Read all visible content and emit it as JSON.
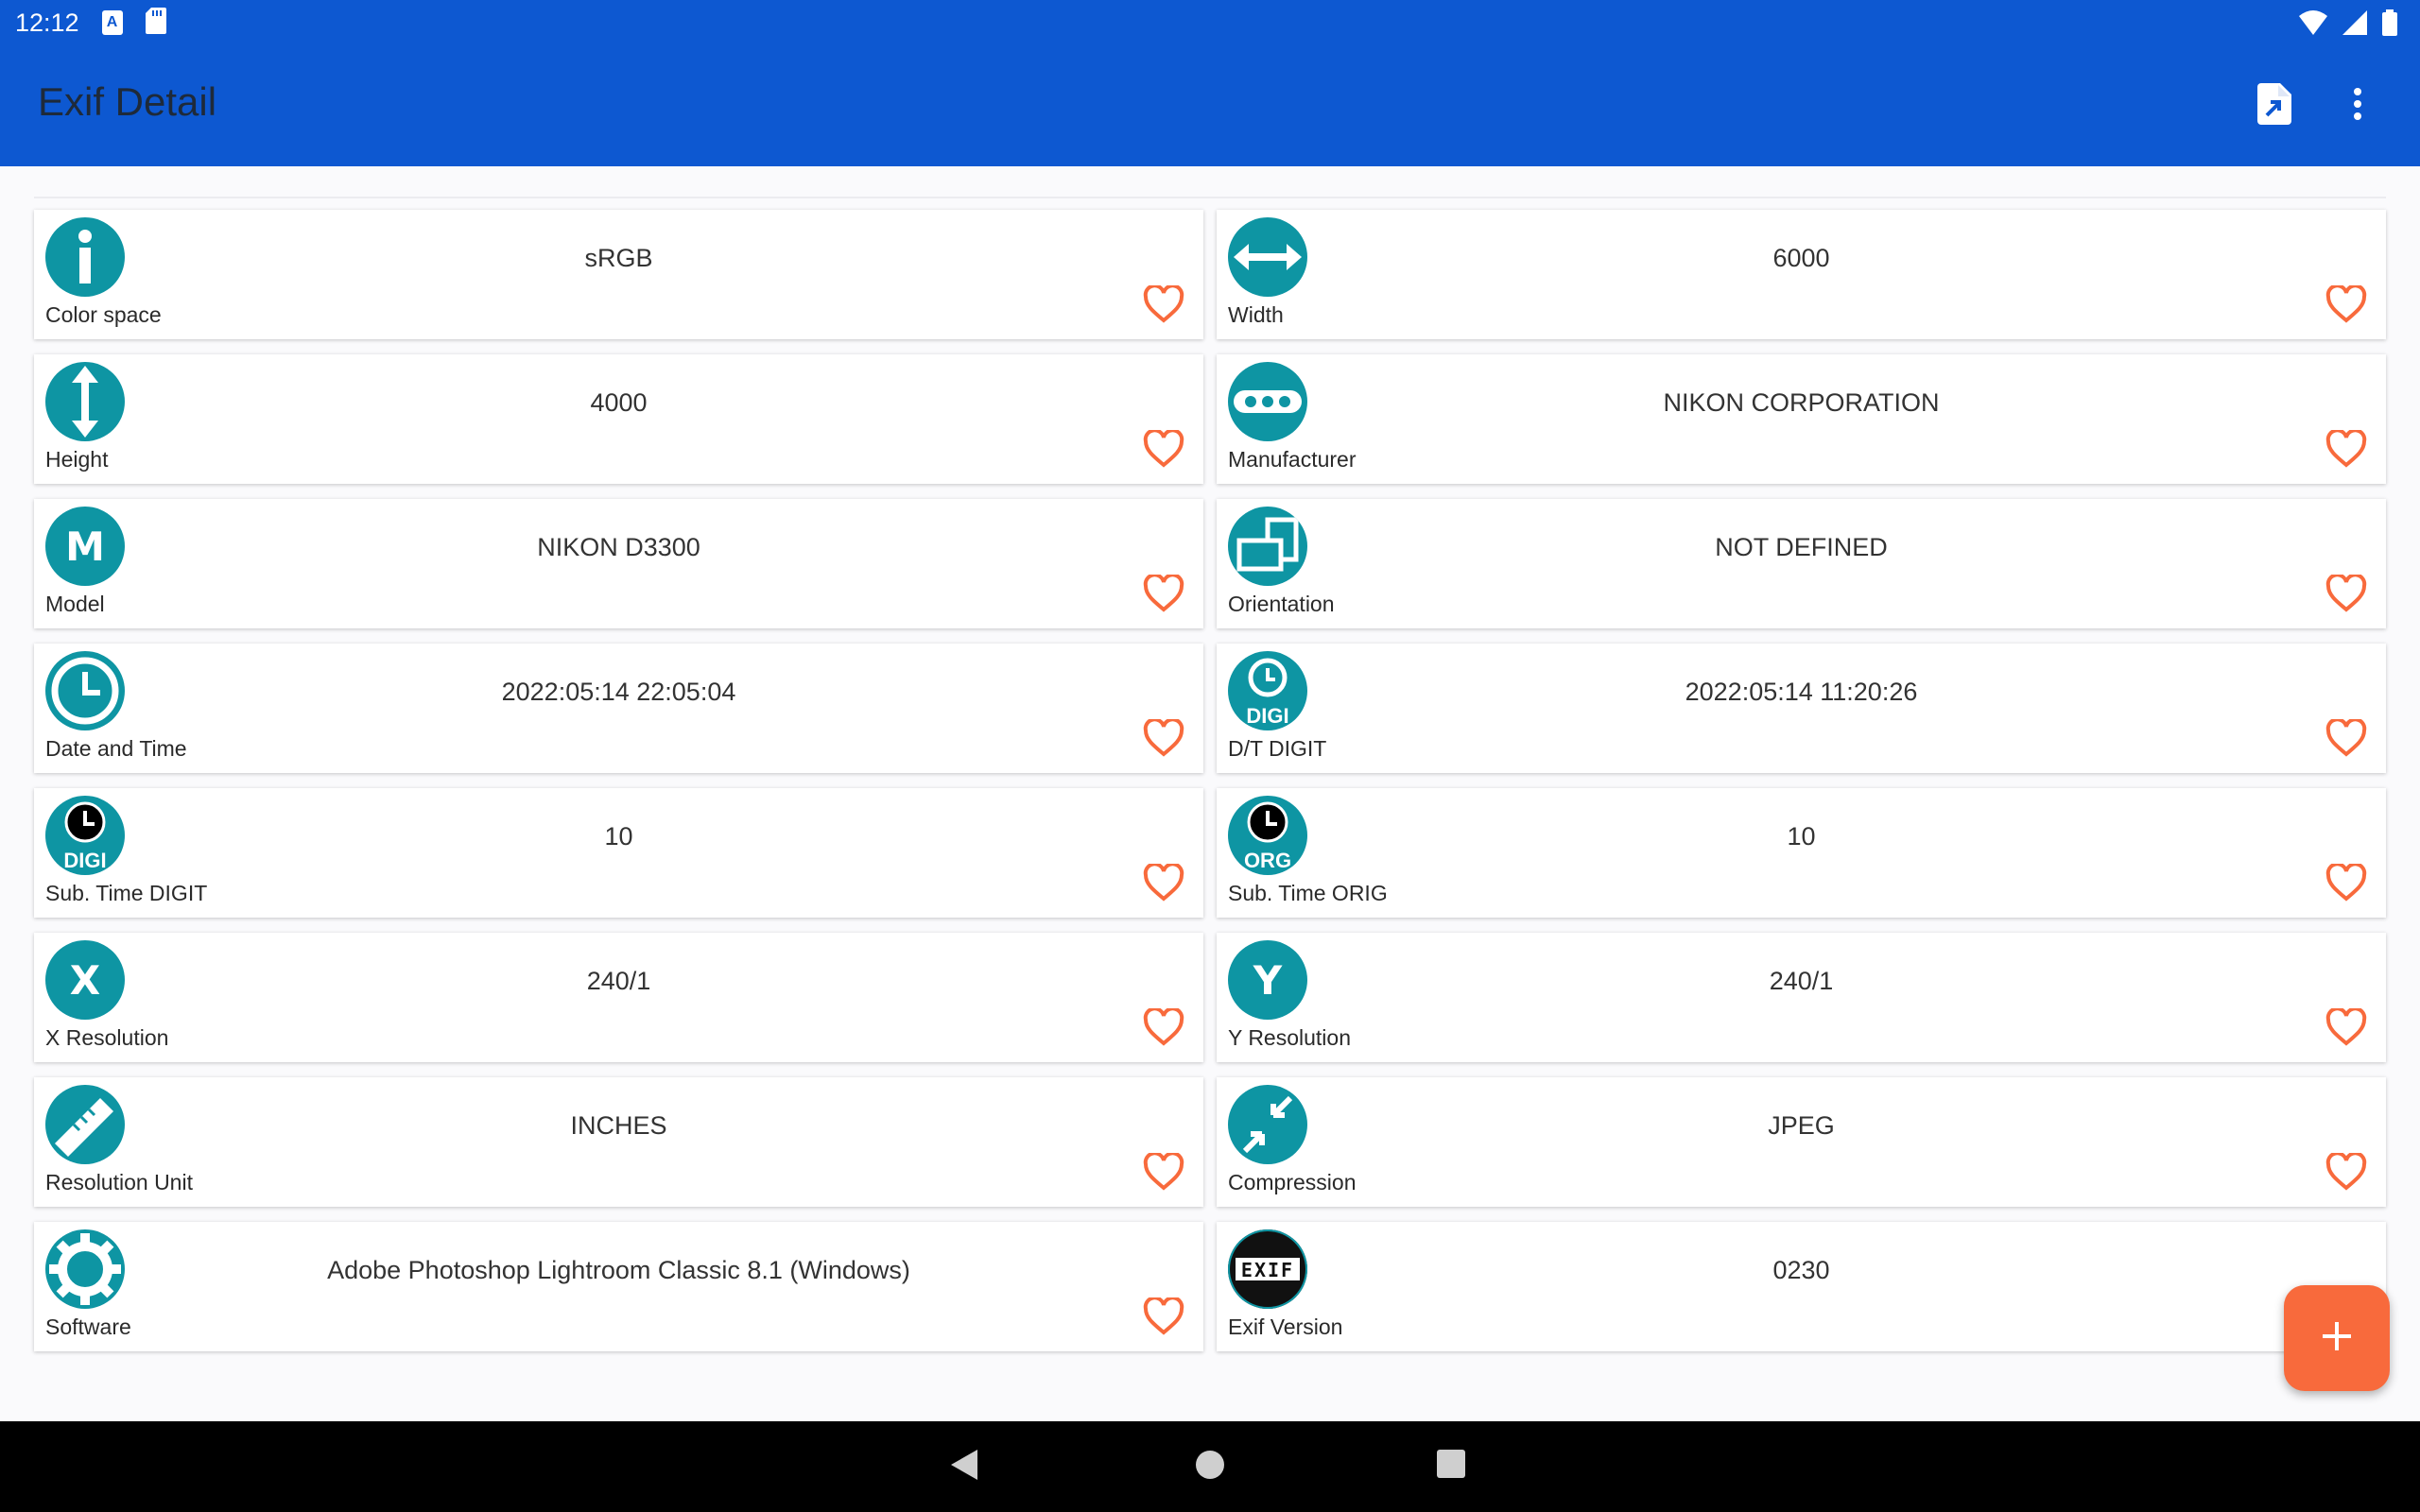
{
  "status": {
    "time": "12:12"
  },
  "app_bar": {
    "title": "Exif Detail"
  },
  "colors": {
    "primary": "#0d58d1",
    "icon_bg": "#0e95a3",
    "accent": "#f86a3c"
  },
  "items": [
    {
      "label": "Color space",
      "value": "sRGB",
      "icon": "info-icon"
    },
    {
      "label": "Width",
      "value": "6000",
      "icon": "width-arrows-icon"
    },
    {
      "label": "Height",
      "value": "4000",
      "icon": "height-arrows-icon"
    },
    {
      "label": "Manufacturer",
      "value": "NIKON CORPORATION",
      "icon": "manufacturer-icon"
    },
    {
      "label": "Model",
      "value": "NIKON D3300",
      "icon": "model-icon"
    },
    {
      "label": "Orientation",
      "value": "NOT DEFINED",
      "icon": "orientation-icon"
    },
    {
      "label": "Date and Time",
      "value": "2022:05:14 22:05:04",
      "icon": "clock-icon"
    },
    {
      "label": "D/T DIGIT",
      "value": "2022:05:14 11:20:26",
      "icon": "clock-digi-icon",
      "badge": "DIGI"
    },
    {
      "label": "Sub. Time DIGIT",
      "value": "10",
      "icon": "subtime-digi-icon",
      "badge": "DIGI"
    },
    {
      "label": "Sub. Time ORIG",
      "value": "10",
      "icon": "subtime-orig-icon",
      "badge": "ORG"
    },
    {
      "label": "X Resolution",
      "value": "240/1",
      "icon": "x-icon",
      "letter": "X"
    },
    {
      "label": "Y Resolution",
      "value": "240/1",
      "icon": "y-icon",
      "letter": "Y"
    },
    {
      "label": "Resolution Unit",
      "value": "INCHES",
      "icon": "ruler-icon"
    },
    {
      "label": "Compression",
      "value": "JPEG",
      "icon": "compress-icon"
    },
    {
      "label": "Software",
      "value": "Adobe Photoshop Lightroom Classic 8.1 (Windows)",
      "icon": "gear-icon"
    },
    {
      "label": "Exif Version",
      "value": "0230",
      "icon": "exif-icon",
      "badge": "EXIF"
    }
  ],
  "model_letter": "M"
}
